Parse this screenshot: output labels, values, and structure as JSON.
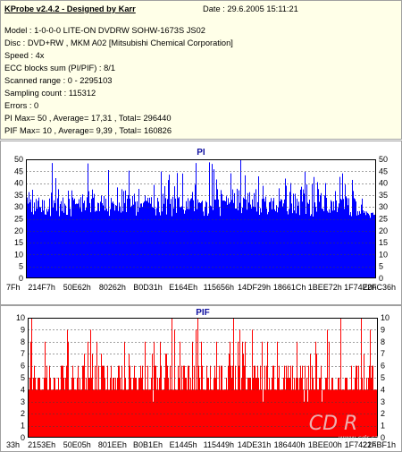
{
  "info": {
    "title": "KProbe v2.4.2 - Designed by Karr",
    "date": "Date : 29.6.2005 15:11:21",
    "lines": [
      "Model : 1-0-0-0 LITE-ON DVDRW SOHW-1673S JS02",
      "Disc : DVD+RW , MKM A02 [Mitsubishi Chemical Corporation]",
      "Speed : 4x",
      "ECC blocks sum (PI/PIF) : 8/1",
      "Scanned range : 0 - 2295103",
      "Sampling count : 115312",
      "Errors : 0",
      "PI Max= 50 , Average= 17,31 , Total= 296440",
      "PIF Max= 10 , Average= 9,39 , Total= 160826"
    ]
  },
  "watermark": {
    "text": "CD R",
    "url": "www.cdr.cz"
  },
  "colors": {
    "pi": "#0000ff",
    "pif": "#ff0000",
    "background": "#ffffe8"
  },
  "chart_data": [
    {
      "type": "bar",
      "title": "PI",
      "ylim": [
        0,
        50
      ],
      "yticks": [
        0,
        5,
        10,
        15,
        20,
        25,
        30,
        35,
        40,
        45,
        50
      ],
      "xtick_labels": [
        "7Fh",
        "214F7h",
        "50E62h",
        "80262h",
        "B0D31h",
        "E164Eh",
        "115656h",
        "14DF29h",
        "18661Ch",
        "1BEE72h",
        "1F74E0h",
        "22FC36h"
      ],
      "grid": true,
      "typical_range": [
        25,
        38
      ],
      "max": 50,
      "average": 17.31
    },
    {
      "type": "bar",
      "title": "PIF",
      "ylim": [
        0,
        10
      ],
      "yticks": [
        0,
        1,
        2,
        3,
        4,
        5,
        6,
        7,
        8,
        9,
        10
      ],
      "xtick_labels": [
        "33h",
        "2153Eh",
        "50E05h",
        "801EEh",
        "B0B1Eh",
        "E1445h",
        "115449h",
        "14DE31h",
        "186440h",
        "1BEE00h",
        "1F7421h",
        "22FBF1h"
      ],
      "grid": true,
      "typical_range": [
        4,
        6
      ],
      "max": 10,
      "average": 9.39
    }
  ]
}
